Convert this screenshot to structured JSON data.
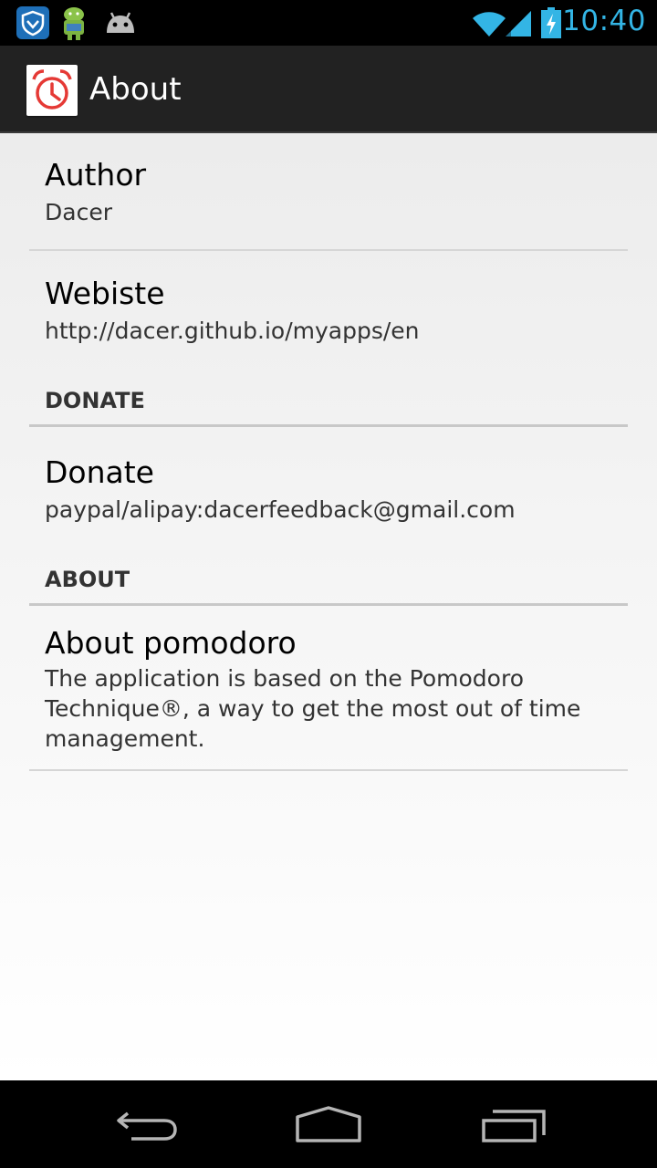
{
  "status_bar": {
    "time": "10:40",
    "icons": [
      "shield-app-icon",
      "android-app-icon",
      "android-robot-icon",
      "wifi-icon",
      "signal-icon",
      "battery-charging-icon"
    ],
    "accent_color": "#33b5e5"
  },
  "action_bar": {
    "title": "About",
    "app_icon": "alarm-clock-icon",
    "icon_color": "#e53935"
  },
  "preferences": [
    {
      "title": "Author",
      "summary": "Dacer"
    },
    {
      "title": "Webiste",
      "summary": "http://dacer.github.io/myapps/en"
    }
  ],
  "categories": {
    "donate": {
      "header": "DONATE",
      "items": [
        {
          "title": "Donate",
          "summary": "paypal/alipay:dacerfeedback@gmail.com"
        }
      ]
    },
    "about": {
      "header": "ABOUT",
      "items": [
        {
          "title": "About pomodoro",
          "summary_lines": [
            "The application is based on the Pomodoro",
            "Technique®, a way to get the most out of time",
            "management."
          ]
        }
      ]
    }
  },
  "nav_bar": {
    "buttons": [
      "back-icon",
      "home-icon",
      "recent-apps-icon"
    ]
  }
}
